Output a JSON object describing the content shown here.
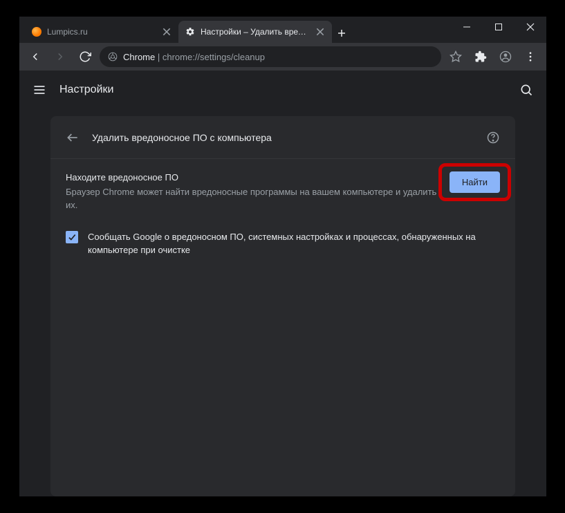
{
  "window": {
    "controls": {
      "minimize": "minimize",
      "maximize": "maximize",
      "close": "close"
    }
  },
  "tabs": [
    {
      "title": "Lumpics.ru",
      "active": false
    },
    {
      "title": "Настройки – Удалить вредонос",
      "active": true
    }
  ],
  "toolbar": {
    "url_scheme": "Chrome",
    "url_sep": " | ",
    "url_path": "chrome://settings/cleanup"
  },
  "settings": {
    "header_title": "Настройки",
    "card": {
      "title": "Удалить вредоносное ПО с компьютера",
      "find": {
        "title": "Находите вредоносное ПО",
        "desc": "Браузер Chrome может найти вредоносные программы на вашем компьютере и удалить их.",
        "button": "Найти"
      },
      "report": {
        "checked": true,
        "label": "Сообщать Google о вредоносном ПО, системных настройках и процессах, обнаруженных на компьютере при очистке"
      }
    }
  }
}
